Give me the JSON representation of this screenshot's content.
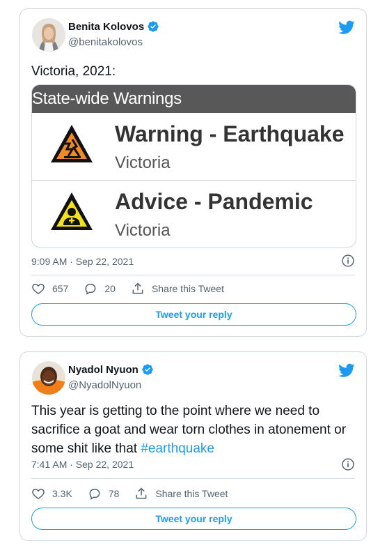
{
  "tweets": [
    {
      "author": {
        "name": "Benita Kolovos",
        "handle": "@benitakolovos",
        "verified": true
      },
      "text": "Victoria, 2021:",
      "media": {
        "header": "State-wide Warnings",
        "alerts": [
          {
            "title": "Warning - Earthquake",
            "region": "Victoria",
            "icon": "earthquake-warning-icon"
          },
          {
            "title": "Advice - Pandemic",
            "region": "Victoria",
            "icon": "pandemic-advice-icon"
          }
        ]
      },
      "timestamp": "9:09 AM · Sep 22, 2021",
      "likes": "657",
      "replies": "20",
      "share_label": "Share this Tweet",
      "reply_button": "Tweet your reply"
    },
    {
      "author": {
        "name": "Nyadol Nyuon",
        "handle": "@NyadolNyuon",
        "verified": true
      },
      "text": "This year is getting to the point where we need to sacrifice a goat and wear torn clothes in atonement or some shit like that ",
      "hashtag": "#earthquake",
      "timestamp": "7:41 AM · Sep 22, 2021",
      "likes": "3.3K",
      "replies": "78",
      "share_label": "Share this Tweet",
      "reply_button": "Tweet your reply"
    }
  ],
  "colors": {
    "accent": "#1d9bf0",
    "text": "#0f1419",
    "muted": "#536471",
    "border": "#cfd9de",
    "warning": "#f5a623",
    "warning_header": "#585858"
  }
}
